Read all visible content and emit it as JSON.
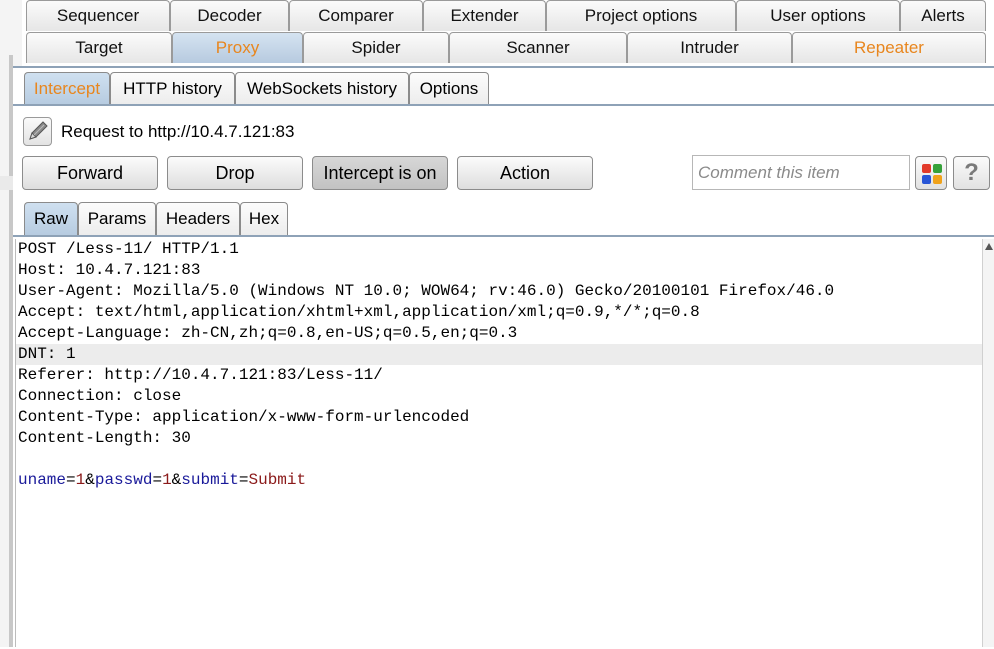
{
  "top_tabs_row1": [
    "Sequencer",
    "Decoder",
    "Comparer",
    "Extender",
    "Project options",
    "User options",
    "Alerts"
  ],
  "top_tabs_row2": [
    "Target",
    "Proxy",
    "Spider",
    "Scanner",
    "Intruder",
    "Repeater"
  ],
  "proxy_tabs": [
    "Intercept",
    "HTTP history",
    "WebSockets history",
    "Options"
  ],
  "request_label": "Request to http://10.4.7.121:83",
  "buttons": {
    "forward": "Forward",
    "drop": "Drop",
    "intercept": "Intercept is on",
    "action": "Action"
  },
  "comment_placeholder": "Comment this item",
  "help_label": "?",
  "view_tabs": [
    "Raw",
    "Params",
    "Headers",
    "Hex"
  ],
  "request_lines": [
    "POST /Less-11/ HTTP/1.1",
    "Host: 10.4.7.121:83",
    "User-Agent: Mozilla/5.0 (Windows NT 10.0; WOW64; rv:46.0) Gecko/20100101 Firefox/46.0",
    "Accept: text/html,application/xhtml+xml,application/xml;q=0.9,*/*;q=0.8",
    "Accept-Language: zh-CN,zh;q=0.8,en-US;q=0.5,en;q=0.3",
    "DNT: 1",
    "Referer: http://10.4.7.121:83/Less-11/",
    "Connection: close",
    "Content-Type: application/x-www-form-urlencoded",
    "Content-Length: 30",
    ""
  ],
  "body_params": [
    {
      "key": "uname",
      "value": "1"
    },
    {
      "key": "passwd",
      "value": "1"
    },
    {
      "key": "submit",
      "value": "Submit"
    }
  ],
  "colors": {
    "accent_orange": "#e8861e",
    "param_key": "#1a1a9a",
    "param_value": "#8b1a1a",
    "selected_tab": "#b7cadf"
  }
}
